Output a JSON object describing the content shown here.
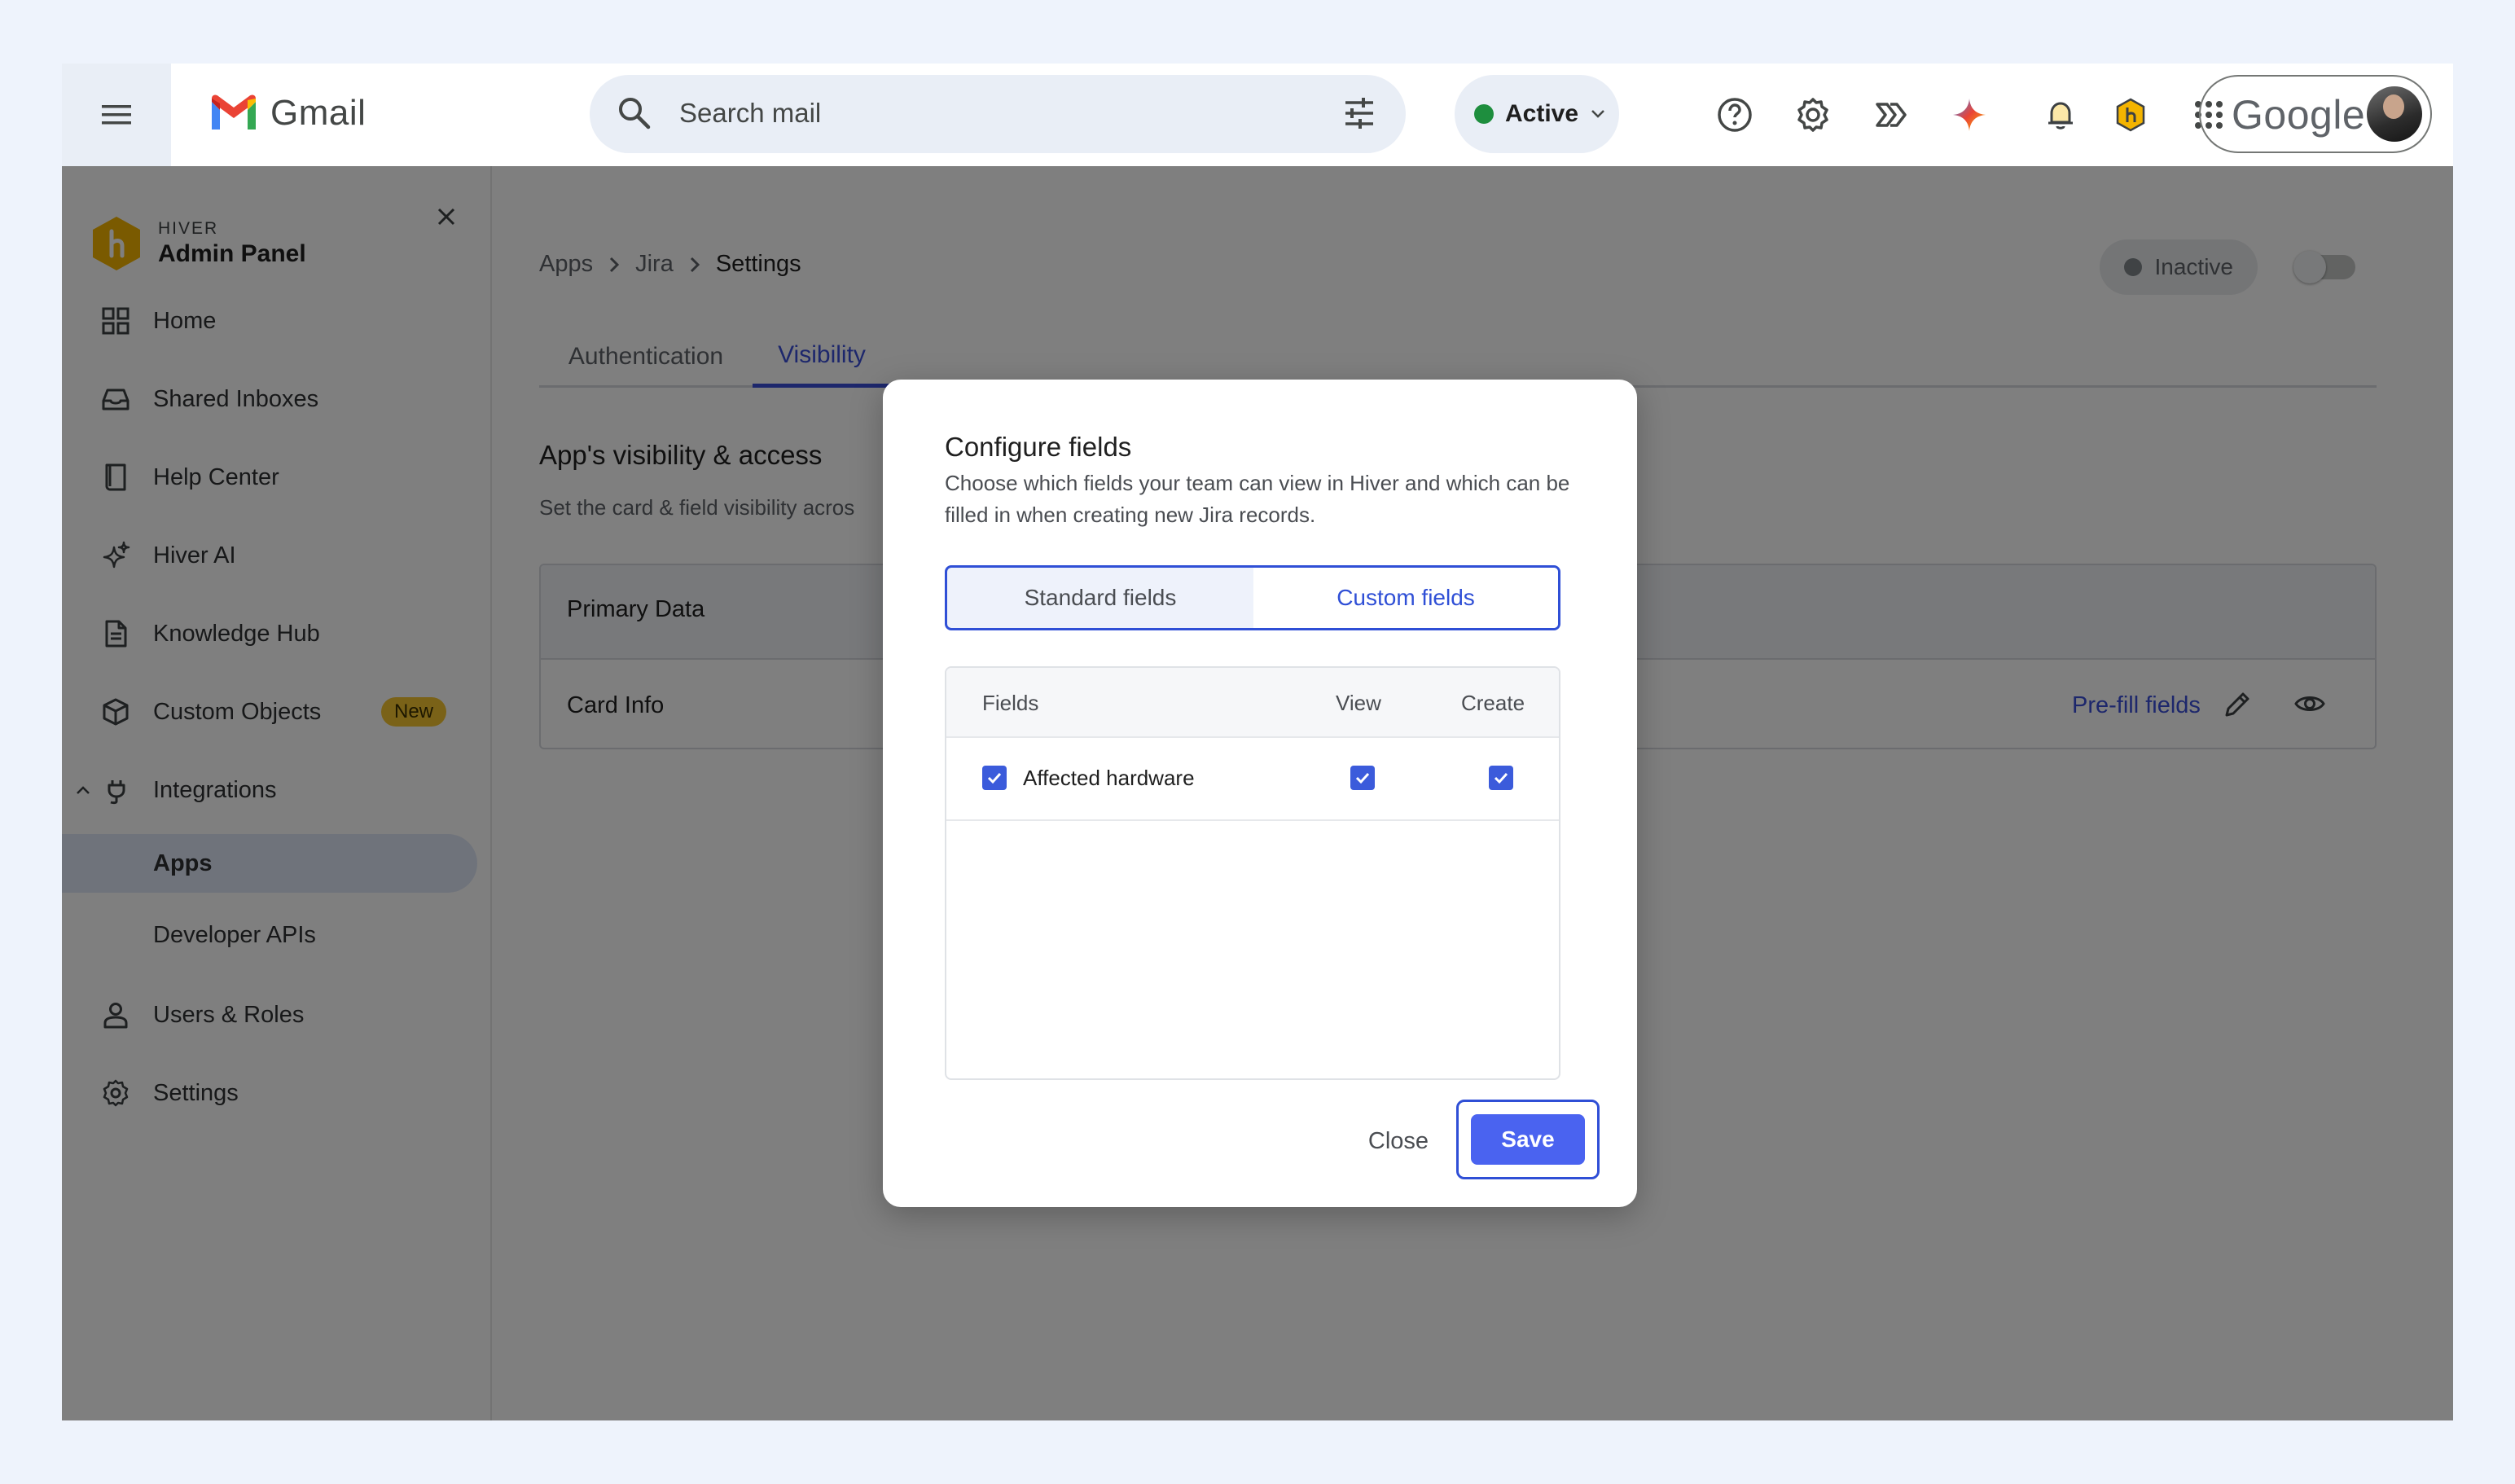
{
  "gmail": {
    "brand": "Gmail",
    "search_placeholder": "Search mail",
    "status": "Active",
    "account_brand": "Google"
  },
  "hiver": {
    "brand_small": "HIVER",
    "brand_title": "Admin Panel",
    "nav": {
      "home": "Home",
      "shared_inboxes": "Shared Inboxes",
      "help_center": "Help Center",
      "hiver_ai": "Hiver AI",
      "knowledge_hub": "Knowledge Hub",
      "custom_objects": "Custom Objects",
      "custom_objects_badge": "New",
      "integrations": "Integrations",
      "apps": "Apps",
      "developer_apis": "Developer APIs",
      "users_roles": "Users & Roles",
      "settings": "Settings"
    }
  },
  "main": {
    "breadcrumb": [
      "Apps",
      "Jira",
      "Settings"
    ],
    "status_pill": "Inactive",
    "tabs": [
      "Authentication",
      "Visibility"
    ],
    "section_title": "App's visibility & access",
    "section_subtitle": "Set the card & field visibility acros",
    "card_header": "Primary Data",
    "card_row": "Card Info",
    "prefill_link": "Pre-fill fields"
  },
  "modal": {
    "title": "Configure fields",
    "description": "Choose which fields your team can view in Hiver and which can be filled in when creating new Jira records.",
    "segments": [
      "Standard fields",
      "Custom fields"
    ],
    "columns": [
      "Fields",
      "View",
      "Create"
    ],
    "rows": [
      {
        "label": "Affected hardware",
        "selected": true,
        "view": true,
        "create": true
      }
    ],
    "close_label": "Close",
    "save_label": "Save"
  },
  "colors": {
    "accent": "#3b4fd8",
    "active_green": "#1e8e3e",
    "badge_yellow": "#f4c430"
  }
}
